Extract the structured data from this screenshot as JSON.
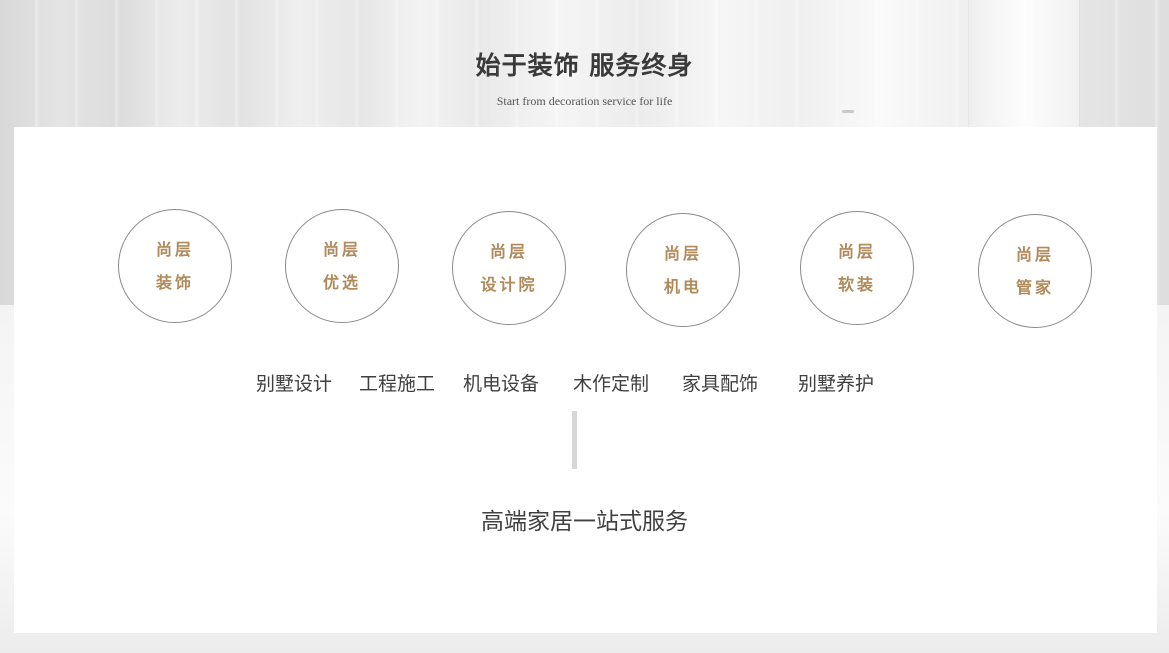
{
  "header": {
    "title": "始于装饰  服务终身",
    "subtitle": "Start from decoration service for life"
  },
  "circles": [
    {
      "line1": "尚层",
      "line2": "装饰"
    },
    {
      "line1": "尚层",
      "line2": "优选"
    },
    {
      "line1": "尚层",
      "line2": "设计院"
    },
    {
      "line1": "尚层",
      "line2": "机电"
    },
    {
      "line1": "尚层",
      "line2": "软装"
    },
    {
      "line1": "尚层",
      "line2": "管家"
    }
  ],
  "services": [
    "别墅设计",
    "工程施工",
    "机电设备",
    "木作定制",
    "家具配饰",
    "别墅养护"
  ],
  "tagline": "高端家居一站式服务",
  "colors": {
    "accent": "#b08a5a",
    "text": "#404040",
    "circle_border": "#8a8a8a"
  }
}
